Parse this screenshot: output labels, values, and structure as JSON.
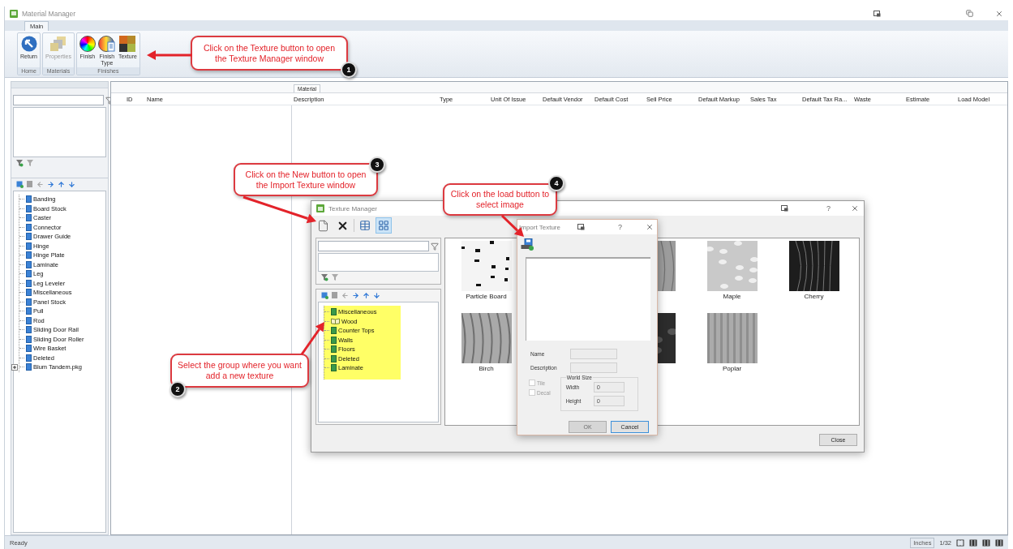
{
  "window": {
    "title": "Material Manager"
  },
  "ribbon": {
    "tabs": [
      {
        "label": "Main",
        "selected": true
      }
    ],
    "groups": [
      {
        "label": "Home",
        "buttons": [
          {
            "label": "Return",
            "kind": "return",
            "disabled": false
          }
        ]
      },
      {
        "label": "Materials",
        "buttons": [
          {
            "label": "Properties",
            "kind": "properties",
            "disabled": true
          }
        ]
      },
      {
        "label": "Finishes",
        "buttons": [
          {
            "label": "Finish",
            "kind": "finish",
            "disabled": false
          },
          {
            "label": "Finish Type",
            "kind": "finish-type",
            "disabled": false
          },
          {
            "label": "Texture",
            "kind": "texture",
            "disabled": false
          }
        ]
      }
    ]
  },
  "left_panel": {
    "categories": [
      {
        "label": "Banding",
        "kind": "folder"
      },
      {
        "label": "Board Stock",
        "kind": "folder"
      },
      {
        "label": "Caster",
        "kind": "folder"
      },
      {
        "label": "Connector",
        "kind": "folder"
      },
      {
        "label": "Drawer Guide",
        "kind": "folder"
      },
      {
        "label": "Hinge",
        "kind": "folder"
      },
      {
        "label": "Hinge Plate",
        "kind": "folder"
      },
      {
        "label": "Laminate",
        "kind": "folder"
      },
      {
        "label": "Leg",
        "kind": "folder"
      },
      {
        "label": "Leg Leveler",
        "kind": "folder"
      },
      {
        "label": "Miscellaneous",
        "kind": "folder"
      },
      {
        "label": "Panel Stock",
        "kind": "folder"
      },
      {
        "label": "Pull",
        "kind": "folder"
      },
      {
        "label": "Rod",
        "kind": "folder"
      },
      {
        "label": "Sliding Door Rail",
        "kind": "folder"
      },
      {
        "label": "Sliding Door Roller",
        "kind": "folder"
      },
      {
        "label": "Wire Basket",
        "kind": "folder"
      },
      {
        "label": "Deleted",
        "kind": "folder"
      },
      {
        "label": "Blum Tandem.pkg",
        "kind": "package",
        "expanded": false
      }
    ]
  },
  "grid": {
    "band": "Material",
    "columns": [
      "ID",
      "Name",
      "Description",
      "Type",
      "Unit Of Issue",
      "Default Vendor",
      "Default Cost",
      "Sell Price",
      "Default Markup",
      "Sales Tax",
      "Default Tax Ra...",
      "Waste",
      "Estimate",
      "Load Model"
    ]
  },
  "status_bar": {
    "text": "Ready",
    "unit": "Inches",
    "precision": "1/32"
  },
  "texture_manager": {
    "title": "Texture Manager",
    "help": "?",
    "views": [
      {
        "kind": "list",
        "selected": false
      },
      {
        "kind": "grid",
        "selected": true
      }
    ],
    "tree": [
      {
        "label": "Miscellaneous",
        "selected": false
      },
      {
        "label": "Wood",
        "selected": true
      },
      {
        "label": "Counter Tops",
        "selected": false
      },
      {
        "label": "Walls",
        "selected": false
      },
      {
        "label": "Floors",
        "selected": false
      },
      {
        "label": "Deleted",
        "selected": false
      },
      {
        "label": "Laminate",
        "selected": false
      }
    ],
    "textures": [
      {
        "kind": "texture",
        "name": "Particle Board"
      },
      {
        "kind": "covered"
      },
      {
        "kind": "partial"
      },
      {
        "kind": "texture",
        "name": "Maple"
      },
      {
        "kind": "texture",
        "name": "Cherry"
      },
      {
        "kind": "texture",
        "name": "Birch"
      },
      {
        "kind": "covered"
      },
      {
        "kind": "partial"
      },
      {
        "kind": "texture",
        "name": "Poplar"
      }
    ],
    "close_button": "Close"
  },
  "import_texture": {
    "title": "Import Texture",
    "help": "?",
    "fields": [
      {
        "label": "Name"
      },
      {
        "label": "Description"
      }
    ],
    "options": [
      {
        "label": "Tile",
        "checked": false,
        "disabled": true
      },
      {
        "label": "Decal",
        "checked": false,
        "disabled": true
      }
    ],
    "world_size": {
      "title": "World Size",
      "fields": [
        {
          "label": "Width",
          "value": "0"
        },
        {
          "label": "Height",
          "value": "0"
        }
      ]
    },
    "buttons": [
      {
        "label": "OK",
        "disabled": true
      },
      {
        "label": "Cancel",
        "disabled": false
      }
    ]
  },
  "callouts": [
    {
      "text": "Click on the Texture button to open the Texture Manager window",
      "number": "1"
    },
    {
      "text": "Select the group where you want add a new texture",
      "number": "2"
    },
    {
      "text": "Click on the New button to open the Import Texture window",
      "number": "3"
    },
    {
      "text": "Click on the load button to select image",
      "number": "4"
    }
  ]
}
